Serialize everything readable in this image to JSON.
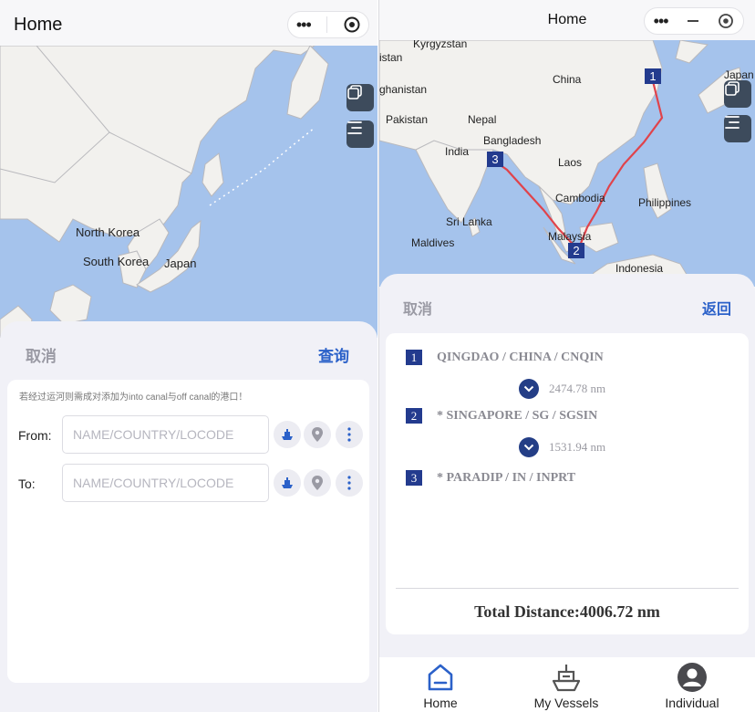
{
  "left": {
    "title": "Home",
    "map_labels": [
      "North Korea",
      "South Korea",
      "Japan"
    ],
    "sheet": {
      "cancel_label": "取消",
      "query_label": "查询",
      "hint": "若经过运河则需成对添加为into canal与off canal的港口！",
      "from_label": "From:",
      "to_label": "To:",
      "from_placeholder": "NAME/COUNTRY/LOCODE",
      "to_placeholder": "NAME/COUNTRY/LOCODE",
      "from_value": "",
      "to_value": ""
    }
  },
  "right": {
    "title": "Home",
    "map_labels": [
      "Kyrgyzstan",
      "istan",
      "China",
      "Japan",
      "ghanistan",
      "Pakistan",
      "Nepal",
      "Bangladesh",
      "India",
      "Laos",
      "Cambodia",
      "Philippines",
      "Sri Lanka",
      "Maldives",
      "Malaysia",
      "Indonesia"
    ],
    "map_markers": [
      "1",
      "2",
      "3"
    ],
    "sheet": {
      "cancel_label": "取消",
      "back_label": "返回",
      "ports": [
        {
          "num": "1",
          "name": "QINGDAO / CHINA / CNQIN"
        },
        {
          "num": "2",
          "name": "* SINGAPORE / SG / SGSIN"
        },
        {
          "num": "3",
          "name": "* PARADIP / IN / INPRT"
        }
      ],
      "legs": [
        "2474.78 nm",
        "1531.94 nm"
      ],
      "total": "Total Distance:4006.72 nm"
    },
    "tabs": [
      {
        "label": "Home",
        "icon": "home-icon",
        "active": true
      },
      {
        "label": "My Vessels",
        "icon": "ship-icon",
        "active": false
      },
      {
        "label": "Individual",
        "icon": "user-icon",
        "active": false
      }
    ]
  },
  "colors": {
    "accent": "#2b61c9",
    "badge": "#233b8e",
    "sea": "#a5c3ec",
    "land": "#f2f1ee",
    "route": "#e0434b"
  }
}
